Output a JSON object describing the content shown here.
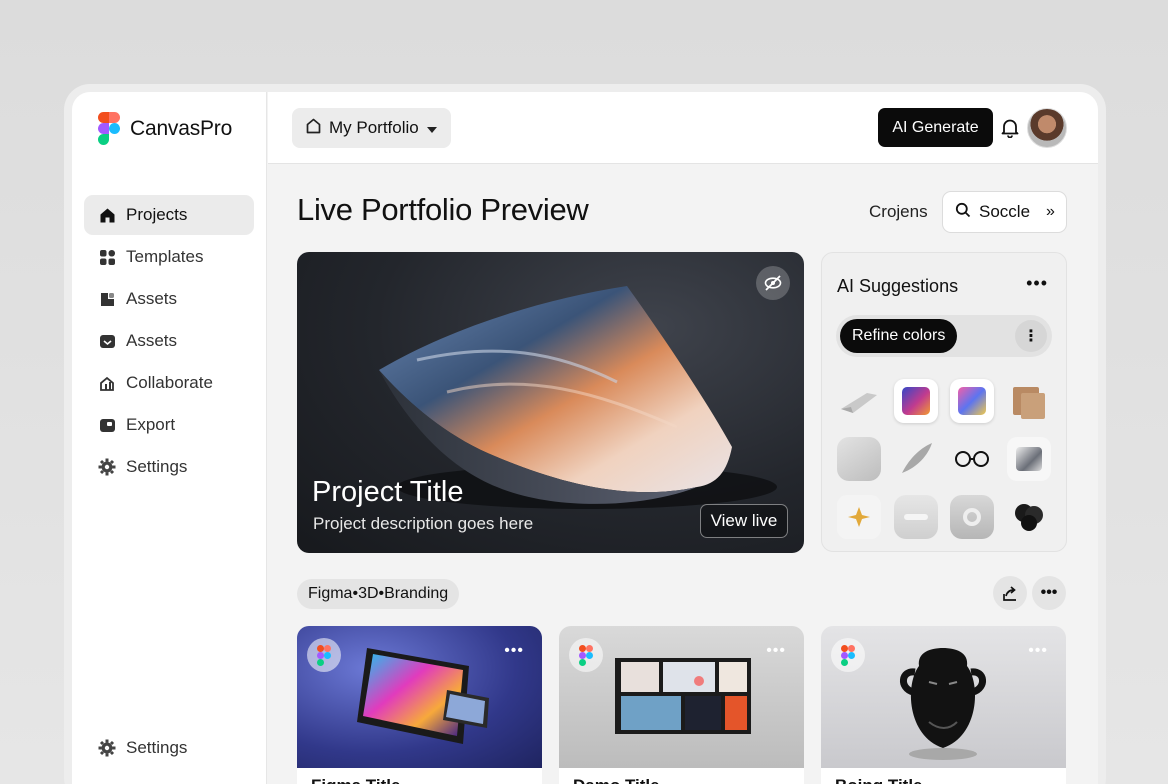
{
  "app": {
    "name": "CanvasPro"
  },
  "sidebar": {
    "items": [
      {
        "label": "Projects",
        "icon": "home-icon",
        "active": true
      },
      {
        "label": "Templates",
        "icon": "templates-icon",
        "active": false
      },
      {
        "label": "Assets",
        "icon": "assets-icon",
        "active": false
      },
      {
        "label": "Assets",
        "icon": "assets-box-icon",
        "active": false
      },
      {
        "label": "Collaborate",
        "icon": "collaborate-icon",
        "active": false
      },
      {
        "label": "Export",
        "icon": "export-icon",
        "active": false
      },
      {
        "label": "Settings",
        "icon": "gear-icon",
        "active": false
      }
    ],
    "bottom_item": {
      "label": "Settings",
      "icon": "gear-icon"
    }
  },
  "topbar": {
    "workspace_label": "My Portfolio",
    "ai_generate_label": "AI Generate"
  },
  "main": {
    "title": "Live Portfolio Preview",
    "filter_label": "Crojens",
    "search_label": "Soccle",
    "hero": {
      "title": "Project Title",
      "description": "Project description goes here",
      "view_live_label": "View live"
    },
    "suggestions": {
      "title": "AI Suggestions",
      "more": "•••",
      "refine_label": "Refine colors"
    },
    "tags": [
      "Figma",
      "3D",
      "Branding"
    ],
    "tag_separator": " • ",
    "cards": [
      {
        "title": "Figma Title"
      },
      {
        "title": "Damo Title"
      },
      {
        "title": "Boing Title"
      }
    ]
  },
  "colors": {
    "accent": "#0b0b0b",
    "sidebar_active": "#ebebeb",
    "background": "#f3f3f3"
  }
}
